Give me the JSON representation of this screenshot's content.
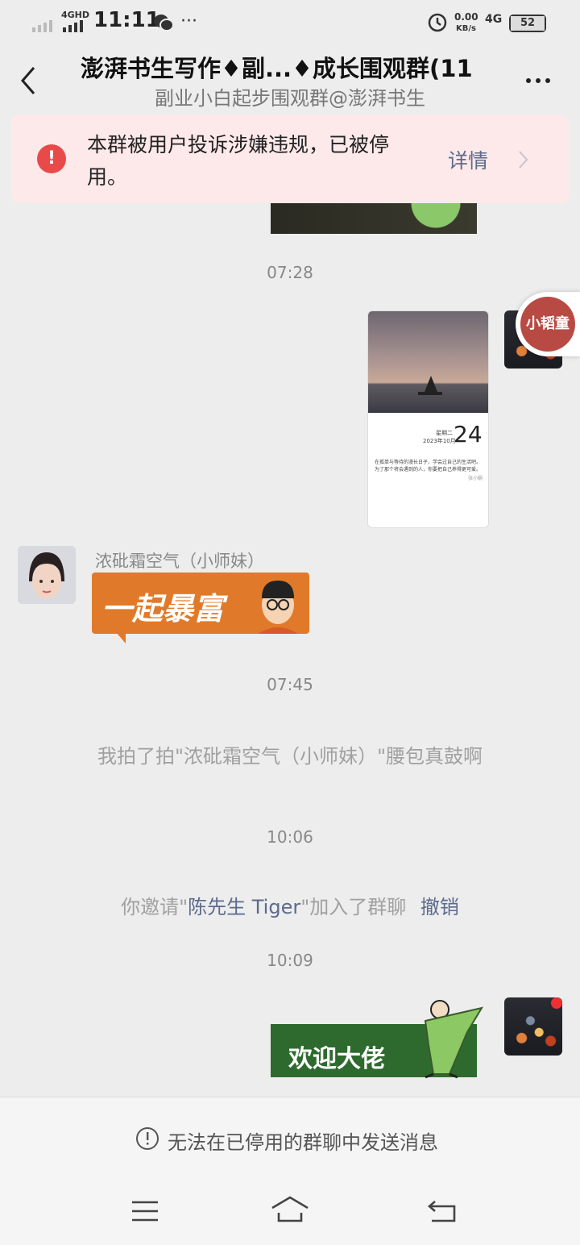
{
  "status_bar": {
    "network": "4GHD",
    "time": "11:11",
    "speed": "0.00",
    "speed_unit": "KB/s",
    "net2": "4G",
    "battery": "52"
  },
  "header": {
    "title": "澎湃书生写作♦副...♦成长围观群(11",
    "subtitle": "副业小白起步围观群@澎湃书生",
    "back_icon": "chevron-left-icon",
    "more_icon": "more-dots-icon"
  },
  "banner": {
    "message": "本群被用户投诉涉嫌违规，已被停用。",
    "details_label": "详情",
    "alert_color": "#e84a4a"
  },
  "floating_badge": {
    "label": "小韬童"
  },
  "messages": {
    "ts1": "07:28",
    "card": {
      "weekday": "星期二",
      "date": "2023年10月",
      "day": "24",
      "text1": "在孤单与等待的漫长日子，学会过自己的生活吧。",
      "text2": "为了那个将会遇到的人，你要把自己养得更可爱。",
      "signature": "张小娴"
    },
    "sender_name": "浓砒霜空气（小师妹）",
    "sticker1_text": "一起暴富",
    "ts2": "07:45",
    "pat_text": "我拍了拍\"浓砒霜空气（小师妹）\"腰包真鼓啊",
    "ts3": "10:06",
    "invite_prefix": "你邀请\"",
    "invite_name": "陈先生 Tiger",
    "invite_suffix": "\"加入了群聊",
    "revoke_label": "撤销",
    "ts4": "10:09",
    "sticker2_text": "欢迎大佬"
  },
  "footer": {
    "disabled_message": "无法在已停用的群聊中发送消息"
  }
}
